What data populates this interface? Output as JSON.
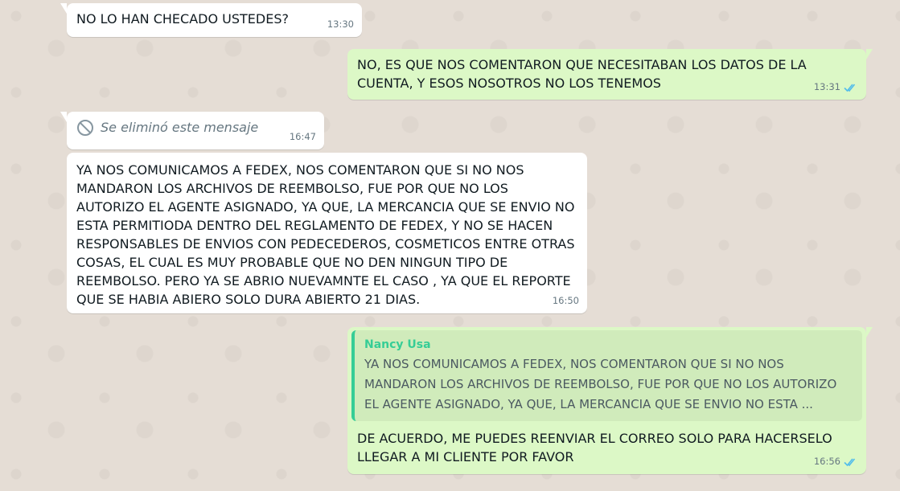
{
  "messages": [
    {
      "text": "NO LO HAN CHECADO USTEDES?",
      "time": "13:30"
    },
    {
      "text": "NO, ES QUE NOS COMENTARON QUE NECESITABAN LOS DATOS DE LA CUENTA, Y ESOS NOSOTROS NO LOS TENEMOS",
      "time": "13:31"
    },
    {
      "text": "Se eliminó este mensaje",
      "time": "16:47"
    },
    {
      "text": "YA NOS COMUNICAMOS A FEDEX, NOS COMENTARON QUE SI NO NOS MANDARON LOS ARCHIVOS DE REEMBOLSO, FUE POR QUE NO LOS AUTORIZO EL AGENTE ASIGNADO, YA QUE, LA MERCANCIA QUE SE ENVIO NO ESTA PERMITIODA DENTRO DEL REGLAMENTO DE FEDEX, Y NO SE HACEN RESPONSABLES DE ENVIOS CON PEDECEDEROS, COSMETICOS ENTRE OTRAS COSAS,  EL CUAL ES MUY PROBABLE QUE NO DEN NINGUN TIPO DE REEMBOLSO. PERO YA  SE ABRIO NUEVAMNTE EL CASO , YA QUE EL REPORTE QUE SE HABIA ABIERO SOLO DURA ABIERTO 21 DIAS.",
      "time": "16:50"
    },
    {
      "quote_author": "Nancy Usa",
      "quote_text": "YA NOS COMUNICAMOS A FEDEX, NOS COMENTARON QUE SI NO NOS MANDARON LOS ARCHIVOS DE REEMBOLSO, FUE POR QUE NO LOS AUTORIZO EL AGENTE ASIGNADO, YA QUE, LA MERCANCIA QUE SE ENVIO NO ESTA ...",
      "text": "DE ACUERDO, ME PUEDES REENVIAR EL CORREO SOLO PARA HACERSELO LLEGAR A MI CLIENTE POR FAVOR",
      "time": "16:56"
    }
  ],
  "colors": {
    "incoming": "#ffffff",
    "outgoing": "#dcf8c6",
    "read_ticks": "#53bdeb",
    "quote_accent": "#35cd96"
  },
  "icons": {
    "deleted": "no-entry-icon",
    "read": "double-check-icon"
  }
}
